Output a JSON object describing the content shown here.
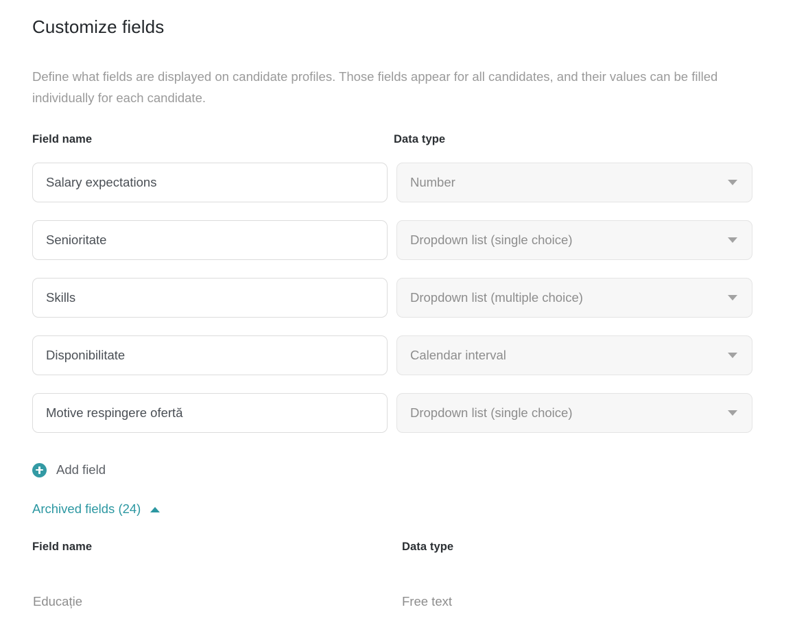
{
  "page": {
    "title": "Customize fields",
    "description": "Define what fields are displayed on candidate profiles. Those fields appear for all candidates, and their values can be filled individually for each candidate."
  },
  "colors": {
    "accent_teal": "#2b97a1",
    "add_icon_teal": "#339aa4",
    "title_text": "#23272b",
    "muted_text": "#9a9a9a",
    "input_border": "#dcdcdc",
    "select_bg": "#f7f7f7",
    "select_border": "#e4e4e4",
    "caret_gray": "#a2a2a2"
  },
  "table": {
    "headers": {
      "field_name": "Field name",
      "data_type": "Data type"
    },
    "rows": [
      {
        "name": "Salary expectations",
        "type": "Number"
      },
      {
        "name": "Senioritate",
        "type": "Dropdown list (single choice)"
      },
      {
        "name": "Skills",
        "type": "Dropdown list (multiple choice)"
      },
      {
        "name": "Disponibilitate",
        "type": "Calendar interval"
      },
      {
        "name": "Motive respingere ofertă",
        "type": "Dropdown list (single choice)"
      }
    ]
  },
  "add_field": {
    "label": "Add field",
    "icon": "plus-circle-icon"
  },
  "archived": {
    "toggle_label": "Archived fields (24)",
    "toggle_icon": "chevron-up-icon",
    "count": 24,
    "expanded": true,
    "headers": {
      "field_name": "Field name",
      "data_type": "Data type"
    },
    "rows": [
      {
        "name": "Educație",
        "type": "Free text"
      }
    ]
  }
}
